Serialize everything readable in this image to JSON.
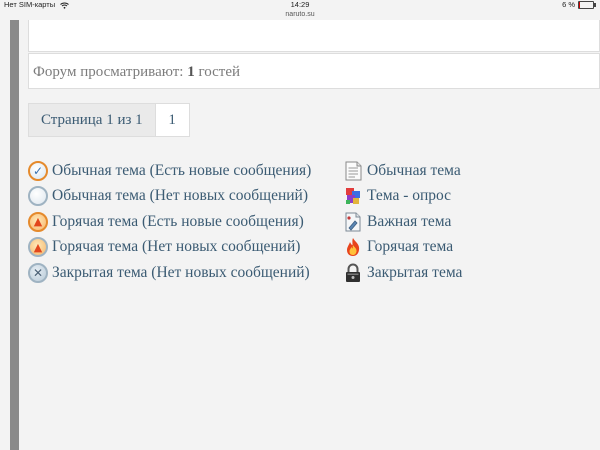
{
  "status_bar": {
    "carrier": "Нет SIM-карты",
    "time": "14:29",
    "battery_text": "6 %",
    "battery_level": 0.06
  },
  "browser": {
    "url": "naruto.su"
  },
  "viewers": {
    "prefix": "Форум просматривают:",
    "count": "1",
    "suffix": "гостей"
  },
  "pagination": {
    "info": "Страница 1 из 1",
    "current_page": "1"
  },
  "legend": {
    "left": [
      {
        "icon": "unread-topic-icon",
        "label": "Обычная тема (Есть новые сообщения)"
      },
      {
        "icon": "read-topic-icon",
        "label": "Обычная тема (Нет новых сообщений)"
      },
      {
        "icon": "hot-unread-topic-icon",
        "label": "Горячая тема (Есть новые сообщения)"
      },
      {
        "icon": "hot-read-topic-icon",
        "label": "Горячая тема (Нет новых сообщений)"
      },
      {
        "icon": "locked-topic-icon",
        "label": "Закрытая тема (Нет новых сообщений)"
      }
    ],
    "right": [
      {
        "icon": "document-icon",
        "label": "Обычная тема"
      },
      {
        "icon": "poll-icon",
        "label": "Тема - опрос"
      },
      {
        "icon": "important-document-icon",
        "label": "Важная тема"
      },
      {
        "icon": "fire-icon",
        "label": "Горячая тема"
      },
      {
        "icon": "padlock-icon",
        "label": "Закрытая тема"
      }
    ]
  }
}
